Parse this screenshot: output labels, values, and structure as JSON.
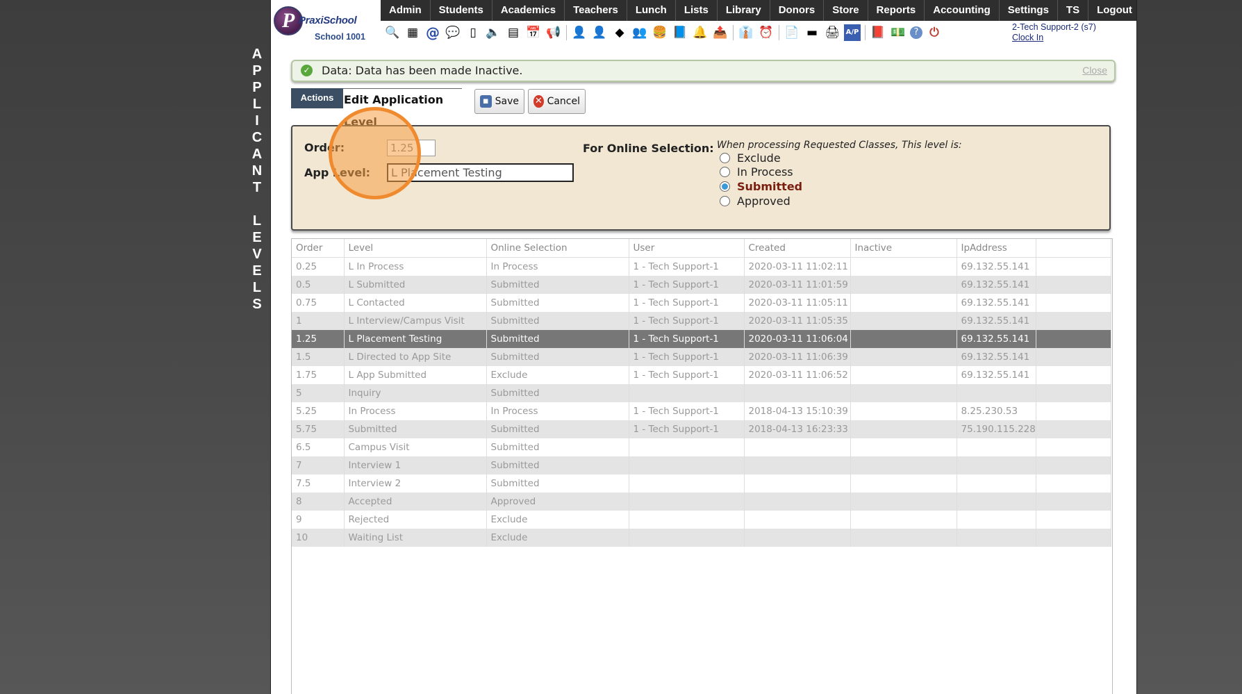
{
  "side_title": "A\nP\nP\nL\nI\nC\nA\nN\nT\n\nL\nE\nV\nE\nL\nS",
  "logo": {
    "brand": "PraxiSchool",
    "mark": "P",
    "school": "School 1001"
  },
  "menu": [
    "Admin",
    "Students",
    "Academics",
    "Teachers",
    "Lunch",
    "Lists",
    "Library",
    "Donors",
    "Store",
    "Reports",
    "Accounting",
    "Settings",
    "TS",
    "Logout"
  ],
  "toolbar_icons": [
    {
      "name": "search-icon",
      "glyph": "🔍"
    },
    {
      "name": "calendar-grid-icon",
      "glyph": "▦"
    },
    {
      "name": "email-at-icon",
      "glyph": "@"
    },
    {
      "name": "chat-icon",
      "glyph": "💬"
    },
    {
      "name": "mobile-icon",
      "glyph": "▯"
    },
    {
      "name": "speaker-icon",
      "glyph": "🔈"
    },
    {
      "name": "schedule-icon",
      "glyph": "▤"
    },
    {
      "name": "calendar-icon",
      "glyph": "📅"
    },
    {
      "name": "megaphone-icon",
      "glyph": "📢"
    },
    {
      "name": "sep",
      "glyph": ""
    },
    {
      "name": "student-icon",
      "glyph": "👤"
    },
    {
      "name": "teacher-icon",
      "glyph": "👤"
    },
    {
      "name": "eraser-icon",
      "glyph": "◆"
    },
    {
      "name": "group-icon",
      "glyph": "👥"
    },
    {
      "name": "lunch-icon",
      "glyph": "🍔"
    },
    {
      "name": "book-icon",
      "glyph": "📘"
    },
    {
      "name": "bell-icon",
      "glyph": "🔔"
    },
    {
      "name": "export-icon",
      "glyph": "📤"
    },
    {
      "name": "sep",
      "glyph": ""
    },
    {
      "name": "staff-icon",
      "glyph": "👔"
    },
    {
      "name": "clock-icon",
      "glyph": "⏰"
    },
    {
      "name": "sep",
      "glyph": ""
    },
    {
      "name": "report-icon",
      "glyph": "📄"
    },
    {
      "name": "card-icon",
      "glyph": "▬"
    },
    {
      "name": "printer-icon",
      "glyph": "🖨"
    },
    {
      "name": "ap-icon",
      "glyph": "A/P"
    },
    {
      "name": "sep",
      "glyph": ""
    },
    {
      "name": "pdf-icon",
      "glyph": "📕"
    },
    {
      "name": "money-icon",
      "glyph": "💵"
    },
    {
      "name": "help-icon",
      "glyph": "?"
    },
    {
      "name": "power-icon",
      "glyph": "⏻"
    }
  ],
  "user": {
    "name": "2-Tech Support-2 (s7)",
    "clock_in": "Clock In"
  },
  "notice": {
    "message": "Data: Data has been made Inactive.",
    "close": "Close"
  },
  "actions": {
    "tab": "Actions",
    "title": "Edit Application Level",
    "save": "Save",
    "cancel": "Cancel"
  },
  "form": {
    "order_label": "Order:",
    "order_value": "1.25",
    "level_label": "App Level:",
    "level_value": "L Placement Testing",
    "online_label": "For Online Selection:",
    "online_hint": "When processing Requested Classes, This level is:",
    "options": [
      {
        "label": "Exclude",
        "checked": false
      },
      {
        "label": "In Process",
        "checked": false
      },
      {
        "label": "Submitted",
        "checked": true
      },
      {
        "label": "Approved",
        "checked": false
      }
    ]
  },
  "table": {
    "columns": [
      "Order",
      "Level",
      "Online Selection",
      "User",
      "Created",
      "Inactive",
      "IpAddress",
      ""
    ],
    "rows": [
      [
        "0.25",
        "L In Process",
        "In Process",
        "1 - Tech Support-1",
        "2020-03-11 11:02:11",
        "",
        "69.132.55.141",
        ""
      ],
      [
        "0.5",
        "L Submitted",
        "Submitted",
        "1 - Tech Support-1",
        "2020-03-11 11:01:59",
        "",
        "69.132.55.141",
        ""
      ],
      [
        "0.75",
        "L Contacted",
        "Submitted",
        "1 - Tech Support-1",
        "2020-03-11 11:05:11",
        "",
        "69.132.55.141",
        ""
      ],
      [
        "1",
        "L Interview/Campus Visit",
        "Submitted",
        "1 - Tech Support-1",
        "2020-03-11 11:05:35",
        "",
        "69.132.55.141",
        ""
      ],
      [
        "1.25",
        "L Placement Testing",
        "Submitted",
        "1 - Tech Support-1",
        "2020-03-11 11:06:04",
        "",
        "69.132.55.141",
        ""
      ],
      [
        "1.5",
        "L Directed to App Site",
        "Submitted",
        "1 - Tech Support-1",
        "2020-03-11 11:06:39",
        "",
        "69.132.55.141",
        ""
      ],
      [
        "1.75",
        "L App Submitted",
        "Exclude",
        "1 - Tech Support-1",
        "2020-03-11 11:06:52",
        "",
        "69.132.55.141",
        ""
      ],
      [
        "5",
        "Inquiry",
        "Submitted",
        "",
        "",
        "",
        "",
        ""
      ],
      [
        "5.25",
        "In Process",
        "In Process",
        "1 - Tech Support-1",
        "2018-04-13 15:10:39",
        "",
        "8.25.230.53",
        ""
      ],
      [
        "5.75",
        "Submitted",
        "Submitted",
        "1 - Tech Support-1",
        "2018-04-13 16:23:33",
        "",
        "75.190.115.228",
        ""
      ],
      [
        "6.5",
        "Campus Visit",
        "Submitted",
        "",
        "",
        "",
        "",
        ""
      ],
      [
        "7",
        "Interview 1",
        "Submitted",
        "",
        "",
        "",
        "",
        ""
      ],
      [
        "7.5",
        "Interview 2",
        "Submitted",
        "",
        "",
        "",
        "",
        ""
      ],
      [
        "8",
        "Accepted",
        "Approved",
        "",
        "",
        "",
        "",
        ""
      ],
      [
        "9",
        "Rejected",
        "Exclude",
        "",
        "",
        "",
        "",
        ""
      ],
      [
        "10",
        "Waiting List",
        "Exclude",
        "",
        "",
        "",
        "",
        ""
      ]
    ],
    "selected_row": 4
  }
}
